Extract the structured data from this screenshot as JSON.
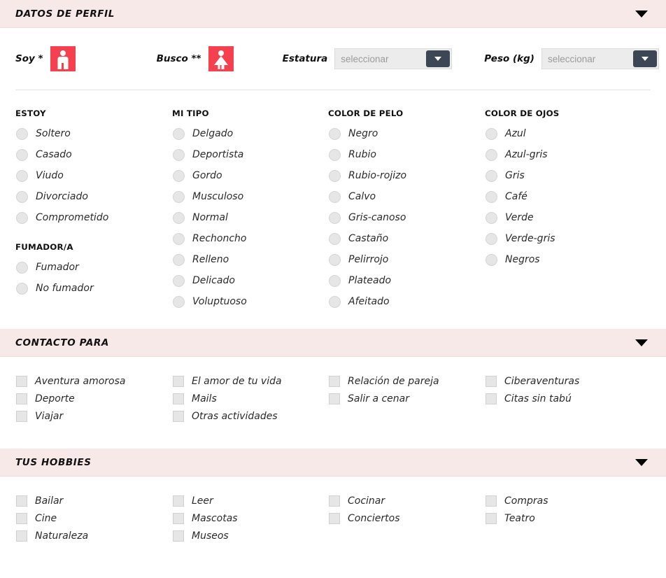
{
  "theme": {
    "header_bg": "#f8e9e9",
    "accent_red": "#f5404f",
    "select_btn": "#3c4654",
    "control_gray": "#e6e6e6"
  },
  "sections": {
    "profile": {
      "title": "DATOS DE PERFIL",
      "collapse_icon": "chevron-down-icon",
      "fields": {
        "soy": {
          "label": "Soy *",
          "icon": "male-gender-icon"
        },
        "busco": {
          "label": "Busco **",
          "icon": "female-gender-icon"
        },
        "estatura": {
          "label": "Estatura",
          "value": "seleccionar",
          "placeholder": "seleccionar"
        },
        "peso": {
          "label": "Peso (kg)",
          "value": "seleccionar",
          "placeholder": "seleccionar"
        }
      },
      "groups": [
        {
          "title": "ESTOY",
          "options": [
            "Soltero",
            "Casado",
            "Viudo",
            "Divorciado",
            "Comprometido"
          ]
        },
        {
          "title": "FUMADOR/A",
          "options": [
            "Fumador",
            "No fumador"
          ]
        },
        {
          "title": "MI TIPO",
          "options": [
            "Delgado",
            "Deportista",
            "Gordo",
            "Musculoso",
            "Normal",
            "Rechoncho",
            "Relleno",
            "Delicado",
            "Voluptuoso"
          ]
        },
        {
          "title": "COLOR DE PELO",
          "options": [
            "Negro",
            "Rubio",
            "Rubio-rojizo",
            "Calvo",
            "Gris-canoso",
            "Castaño",
            "Pelirrojo",
            "Plateado",
            "Afeitado"
          ]
        },
        {
          "title": "COLOR DE OJOS",
          "options": [
            "Azul",
            "Azul-gris",
            "Gris",
            "Café",
            "Verde",
            "Verde-gris",
            "Negros"
          ]
        }
      ]
    },
    "contacto": {
      "title": "CONTACTO PARA",
      "collapse_icon": "chevron-down-icon",
      "columns": [
        [
          "Aventura amorosa",
          "Deporte",
          "Viajar"
        ],
        [
          "El amor de tu vida",
          "Mails",
          "Otras actividades"
        ],
        [
          "Relación de pareja",
          "Salir a cenar"
        ],
        [
          "Ciberaventuras",
          "Citas sin tabú"
        ]
      ]
    },
    "hobbies": {
      "title": "TUS HOBBIES",
      "collapse_icon": "chevron-down-icon",
      "columns": [
        [
          "Bailar",
          "Cine",
          "Naturaleza"
        ],
        [
          "Leer",
          "Mascotas",
          "Museos"
        ],
        [
          "Cocinar",
          "Conciertos"
        ],
        [
          "Compras",
          "Teatro"
        ]
      ]
    }
  }
}
